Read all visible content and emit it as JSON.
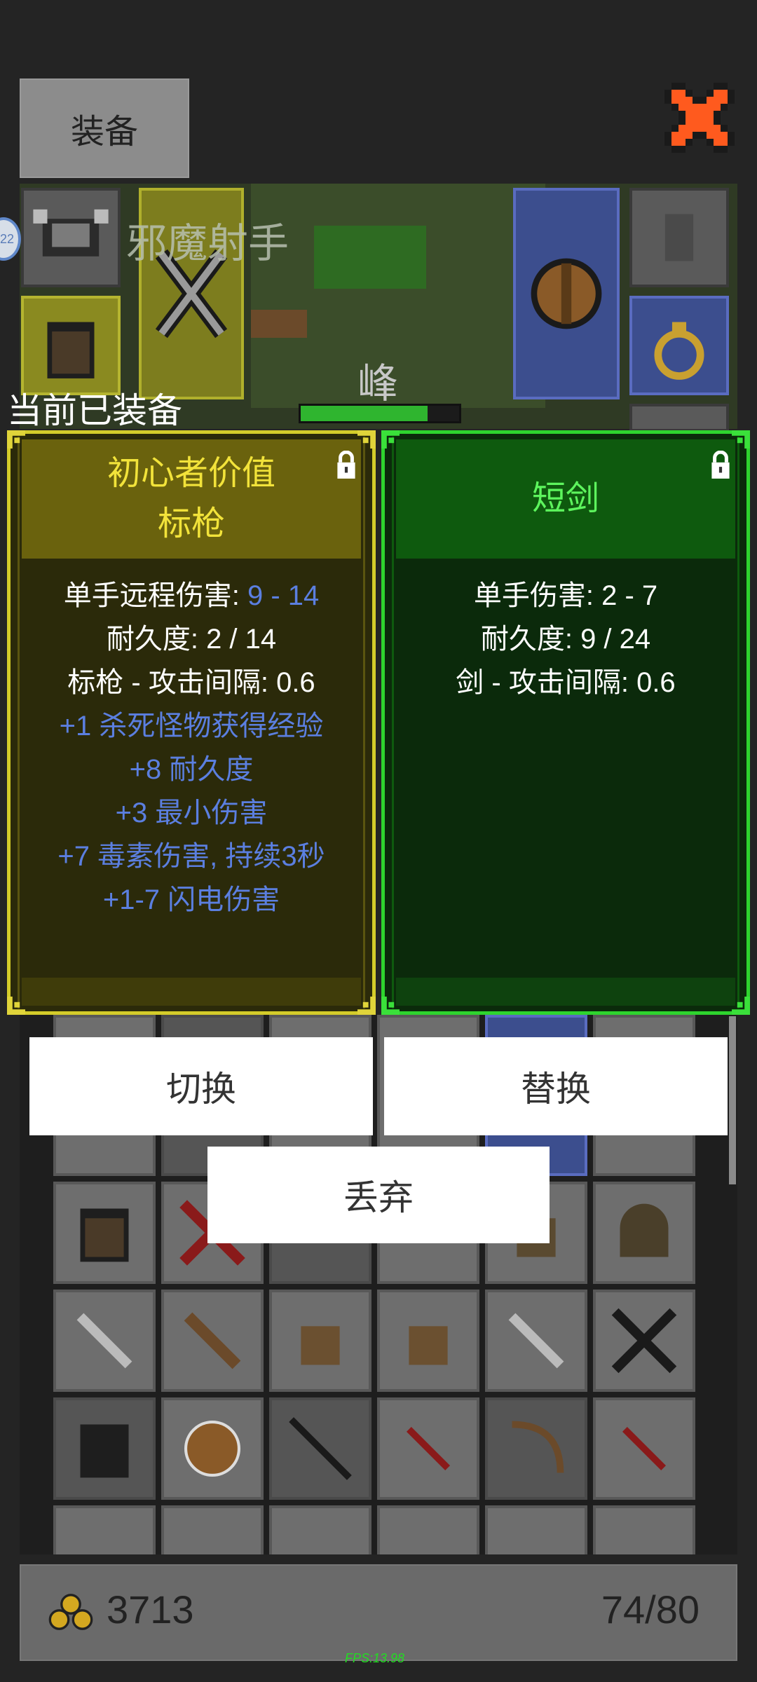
{
  "header": {
    "tab_label": "装备",
    "close_icon": "close-x-icon",
    "close_color": "#ff5a1e"
  },
  "scene": {
    "player_title_faded": "邪魔射手",
    "player_name": "峰",
    "level_badge": "22",
    "hp_fraction": 0.8
  },
  "current_equipped_label": "当前已装备",
  "compare": {
    "new_item": {
      "title_line1": "初心者价值",
      "title_line2": "标枪",
      "rarity_color": "#f2e33a",
      "locked": true,
      "stats": [
        {
          "label": "单手远程伤害: ",
          "value": "9 - 14"
        },
        {
          "text": "耐久度: 2 / 14"
        },
        {
          "text": "标枪 - 攻击间隔: 0.6"
        }
      ],
      "affixes": [
        "+1 杀死怪物获得经验",
        "+8 耐久度",
        "+3 最小伤害",
        "+7 毒素伤害, 持续3秒",
        "+1-7 闪电伤害"
      ]
    },
    "current_item": {
      "title": "短剑",
      "rarity_color": "#5df55d",
      "locked": true,
      "stats": [
        "单手伤害: 2 - 7",
        "耐久度: 9 / 24",
        "剑 - 攻击间隔: 0.6"
      ]
    }
  },
  "actions": {
    "switch_label": "切换",
    "replace_label": "替换",
    "drop_label": "丢弃"
  },
  "footer": {
    "gold": "3713",
    "bag": "74/80",
    "gold_icon": "gold-coins-icon"
  },
  "fps": "FPS:13.98"
}
